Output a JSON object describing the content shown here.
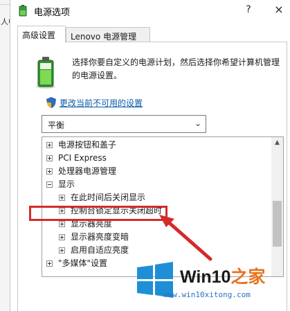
{
  "background_window": {
    "text": "人中"
  },
  "window": {
    "title": "电源选项",
    "help": "?",
    "close": "×"
  },
  "tabs": [
    {
      "label": "高级设置",
      "active": true
    },
    {
      "label": "Lenovo 电源管理",
      "active": false
    }
  ],
  "description": "选择你要自定义的电源计划，然后选择你希望计算机管理的电源设置。",
  "change_link": "更改当前不可用的设置",
  "plan_select": {
    "value": "平衡"
  },
  "tree": [
    {
      "label": "电源按钮和盖子",
      "level": 0,
      "expanded": false
    },
    {
      "label": "PCI Express",
      "level": 0,
      "expanded": false
    },
    {
      "label": "处理器电源管理",
      "level": 0,
      "expanded": false
    },
    {
      "label": "显示",
      "level": 0,
      "expanded": true
    },
    {
      "label": "在此时间后关闭显示",
      "level": 1,
      "expanded": false
    },
    {
      "label": "控制台锁定显示关闭超时",
      "level": 1,
      "expanded": false,
      "highlighted": true
    },
    {
      "label": "显示器亮度",
      "level": 1,
      "expanded": false
    },
    {
      "label": "显示器亮度变暗",
      "level": 1,
      "expanded": false
    },
    {
      "label": "启用自适应亮度",
      "level": 1,
      "expanded": false
    },
    {
      "label": "\"多媒体\"设置",
      "level": 0,
      "expanded": false
    }
  ],
  "watermark": {
    "brand_part1": "Win10",
    "brand_part2": "之家",
    "url": "www.win10xitong.com"
  },
  "colors": {
    "highlight": "#d42a2a",
    "link": "#0a5aa8",
    "logo_blue": "#1e8fd6",
    "brand_orange": "#e8731c"
  }
}
